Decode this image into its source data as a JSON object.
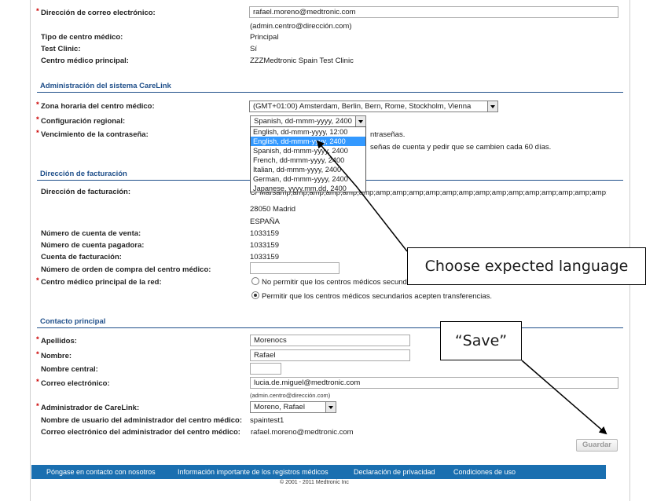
{
  "form": {
    "email_label": "Dirección de correo electrónico:",
    "email_value": "rafael.moreno@medtronic.com",
    "email_hint": "(admin.centro@dirección.com)",
    "clinic_type_label": "Tipo de centro médico:",
    "clinic_type_value": "Principal",
    "test_clinic_label": "Test Clinic:",
    "test_clinic_value": "Sí",
    "main_clinic_label": "Centro médico principal:",
    "main_clinic_value": "ZZZMedtronic Spain Test Clinic"
  },
  "admin_section": {
    "title": "Administración del sistema CareLink",
    "timezone_label": "Zona horaria del centro médico:",
    "timezone_value": "(GMT+01:00) Amsterdam, Berlin, Bern, Rome, Stockholm, Vienna",
    "regional_label": "Configuración regional:",
    "regional_value": "Spanish, dd-mmm-yyyy, 2400",
    "regional_options": [
      "English, dd-mmm-yyyy, 12:00",
      "English, dd-mmm-yyyy, 2400",
      "Spanish, dd-mmm-yyyy, 2400",
      "French, dd-mmm-yyyy, 2400",
      "Italian, dd-mmm-yyyy, 2400",
      "German, dd-mmm-yyyy, 2400",
      "Japanese, yyyy.mm.dd, 2400"
    ],
    "password_label": "Vencimiento de la contraseña:",
    "password_text_1": "ntraseñas.",
    "password_text_2": "señas de cuenta y pedir que se cambien cada 60 días."
  },
  "billing_section": {
    "title": "Dirección de facturación",
    "address_label": "Dirección de facturación:",
    "address_line1": "C/ Marsamp;amp;amp;amp;amp;amp;amp;amp;amp;amp;amp;amp;amp;amp;amp;amp;amp;amp;amp;amp;amp;a",
    "address_city": "28050 Madrid",
    "address_country": "ESPAÑA",
    "sales_account_label": "Número de cuenta de venta:",
    "sales_account_value": "1033159",
    "payer_account_label": "Número de cuenta pagadora:",
    "payer_account_value": "1033159",
    "billing_account_label": "Cuenta de facturación:",
    "billing_account_value": "1033159",
    "po_label": "Número de orden de compra del centro médico:",
    "network_label": "Centro médico principal de la red:",
    "radio_option_1": "No permitir que los centros médicos secundarios acepten transferencias.",
    "radio_option_2": "Permitir que los centros médicos secundarios acepten transferencias."
  },
  "contact_section": {
    "title": "Contacto principal",
    "lastname_label": "Apellidos:",
    "lastname_value": "Morenocs",
    "firstname_label": "Nombre:",
    "firstname_value": "Rafael",
    "middlename_label": "Nombre central:",
    "middlename_value": "",
    "email_label": "Correo electrónico:",
    "email_value": "lucia.de.miguel@medtronic.com",
    "email_hint": "(admin.centro@dirección.com)",
    "carelink_admin_label": "Administrador de CareLink:",
    "carelink_admin_value": "Moreno, Rafael",
    "admin_username_label": "Nombre de usuario del administrador del centro médico:",
    "admin_username_value": "spaintest1",
    "admin_email_label": "Correo electrónico del administrador del centro médico:",
    "admin_email_value": "rafael.moreno@medtronic.com"
  },
  "required_marker": "*",
  "save_label": "Guardar",
  "footer": {
    "links": [
      "Póngase en contacto con nosotros",
      "Información importante de los registros médicos",
      "Declaración de privacidad",
      "Condiciones de uso"
    ],
    "copyright": "© 2001 - 2011 Medtronic Inc"
  },
  "annotations": {
    "language_callout": "Choose expected language",
    "save_callout": "“Save”"
  },
  "colors": {
    "section_title": "#1f4f8a",
    "required": "#cc0000",
    "footer_bg": "#1a6fb0",
    "selection": "#3399ff"
  }
}
